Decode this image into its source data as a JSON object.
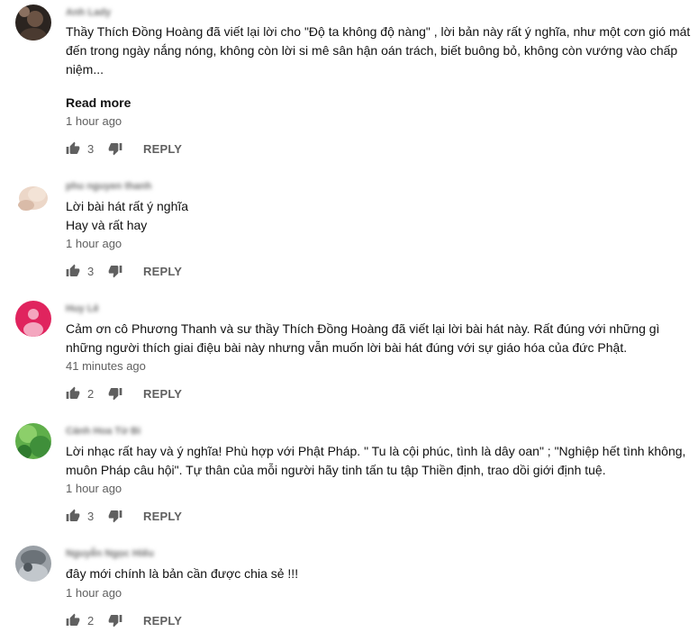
{
  "comments": [
    {
      "author": "Anh Lady",
      "text_lines": [
        "Thầy Thích Đồng Hoàng đã viết lại lời cho \"Độ ta không độ nàng\" , lời bản này rất ý nghĩa, như một cơn gió mát",
        "đến trong ngày nắng nóng, không còn lời si mê sân hận oán trách, biết buông bỏ, không còn vướng vào chấp",
        "niệm..."
      ],
      "read_more": "Read more",
      "time": "1 hour ago",
      "likes": "3",
      "reply": "REPLY",
      "avatar_color": "#3a2f28"
    },
    {
      "author": "phu nguyen thanh",
      "text_lines": [
        "Lời bài hát rất ý nghĩa",
        "Hay và rất hay"
      ],
      "time": "1 hour ago",
      "likes": "3",
      "reply": "REPLY",
      "avatar_color": "#e9d2c2"
    },
    {
      "author": "Huy Lê",
      "text_lines": [
        "Cảm ơn cô Phương Thanh và sư thầy Thích Đồng Hoàng đã viết lại lời bài hát này. Rất đúng với những gì",
        "những người thích giai điệu bài này nhưng vẫn muốn lời bài hát đúng với sự giáo hóa của đức Phật."
      ],
      "time": "41 minutes ago",
      "likes": "2",
      "reply": "REPLY",
      "avatar_color": "#e0245e"
    },
    {
      "author": "Cánh Hoa Từ Bi",
      "text_lines": [
        "Lời nhạc rất hay và ý nghĩa! Phù hợp với Phật Pháp. \" Tu là cội phúc, tình là dây oan\" ; \"Nghiệp hết tình không,",
        "muôn Pháp câu hội\". Tự thân của mỗi người hãy tinh tấn tu tập Thiền định, trao dồi giới định tuệ."
      ],
      "time": "1 hour ago",
      "likes": "3",
      "reply": "REPLY",
      "avatar_color": "#4caf50"
    },
    {
      "author": "Nguyễn Ngọc Hiếu",
      "text_lines": [
        "đây mới chính là bản cần được chia sẻ !!!"
      ],
      "time": "1 hour ago",
      "likes": "2",
      "reply": "REPLY",
      "avatar_color": "#7d858c"
    }
  ],
  "icons": {
    "like": "thumb-up-icon",
    "dislike": "thumb-down-icon"
  }
}
